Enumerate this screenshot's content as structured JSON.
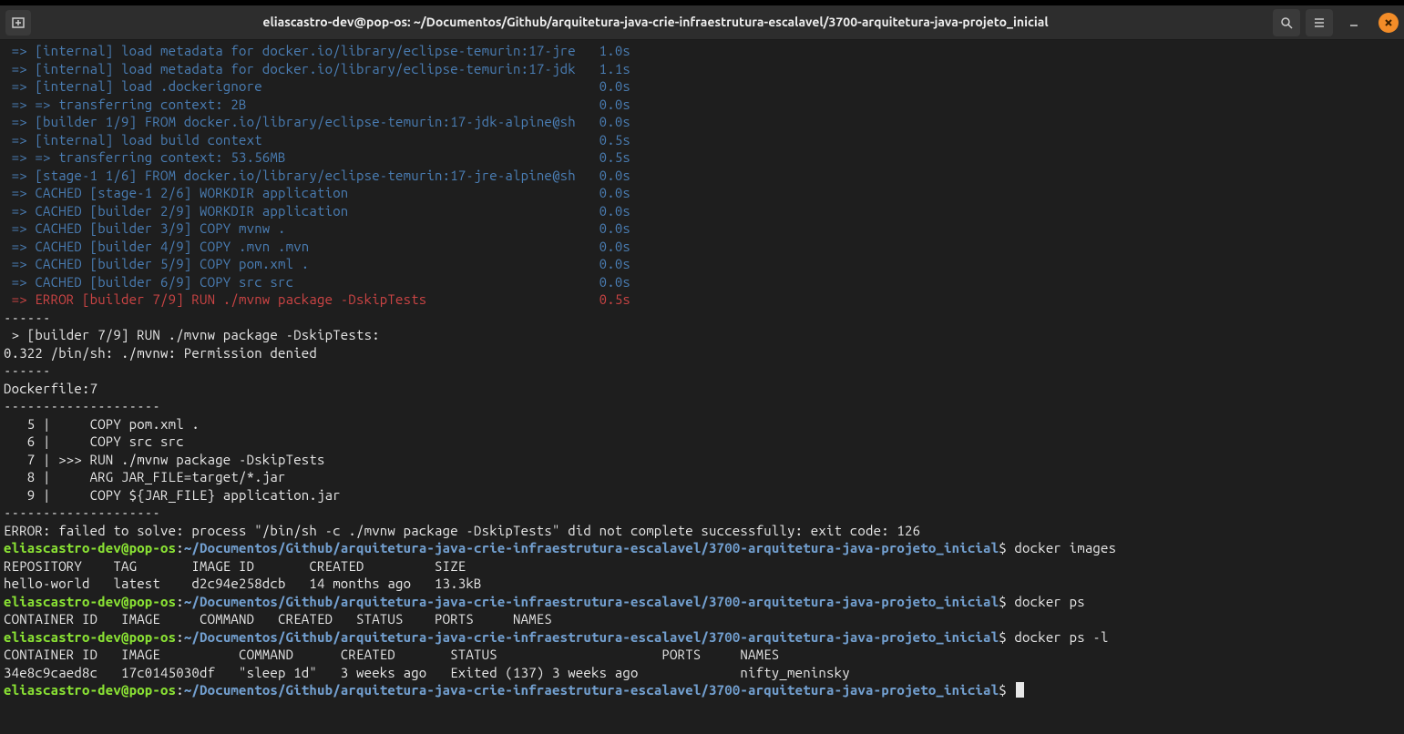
{
  "title": "eliascastro-dev@pop-os: ~/Documentos/Github/arquitetura-java-crie-infraestrutura-escalavel/3700-arquitetura-java-projeto_inicial",
  "build_lines": [
    {
      "text": "[internal] load metadata for docker.io/library/eclipse-temurin:17-jre",
      "time": "1.0s",
      "err": false
    },
    {
      "text": "[internal] load metadata for docker.io/library/eclipse-temurin:17-jdk",
      "time": "1.1s",
      "err": false
    },
    {
      "text": "[internal] load .dockerignore",
      "time": "0.0s",
      "err": false
    },
    {
      "text": "=> transferring context: 2B",
      "time": "0.0s",
      "err": false
    },
    {
      "text": "[builder 1/9] FROM docker.io/library/eclipse-temurin:17-jdk-alpine@sh",
      "time": "0.0s",
      "err": false
    },
    {
      "text": "[internal] load build context",
      "time": "0.5s",
      "err": false
    },
    {
      "text": "=> transferring context: 53.56MB",
      "time": "0.5s",
      "err": false
    },
    {
      "text": "[stage-1 1/6] FROM docker.io/library/eclipse-temurin:17-jre-alpine@sh",
      "time": "0.0s",
      "err": false
    },
    {
      "text": "CACHED [stage-1 2/6] WORKDIR application",
      "time": "0.0s",
      "err": false
    },
    {
      "text": "CACHED [builder 2/9] WORKDIR application",
      "time": "0.0s",
      "err": false
    },
    {
      "text": "CACHED [builder 3/9] COPY mvnw .",
      "time": "0.0s",
      "err": false
    },
    {
      "text": "CACHED [builder 4/9] COPY .mvn .mvn",
      "time": "0.0s",
      "err": false
    },
    {
      "text": "CACHED [builder 5/9] COPY pom.xml .",
      "time": "0.0s",
      "err": false
    },
    {
      "text": "CACHED [builder 6/9] COPY src src",
      "time": "0.0s",
      "err": false
    },
    {
      "text": "ERROR [builder 7/9] RUN ./mvnw package -DskipTests",
      "time": "0.5s",
      "err": true
    }
  ],
  "error_block": {
    "sep1": "------",
    "header": " > [builder 7/9] RUN ./mvnw package -DskipTests:",
    "perm": "0.322 /bin/sh: ./mvnw: Permission denied",
    "sep2": "------",
    "dockerfile": "Dockerfile:7",
    "dashes": "--------------------",
    "lines": [
      "   5 |     COPY pom.xml .",
      "   6 |     COPY src src",
      "   7 | >>> RUN ./mvnw package -DskipTests",
      "   8 |     ARG JAR_FILE=target/*.jar",
      "   9 |     COPY ${JAR_FILE} application.jar"
    ],
    "dashes2": "--------------------",
    "final": "ERROR: failed to solve: process \"/bin/sh -c ./mvnw package -DskipTests\" did not complete successfully: exit code: 126"
  },
  "prompt": {
    "user": "eliascastro-dev@pop-os",
    "sep": ":",
    "path": "~/Documentos/Github/arquitetura-java-crie-infraestrutura-escalavel/3700-arquitetura-java-projeto_inicial",
    "dollar": "$"
  },
  "commands": {
    "images": " docker images",
    "ps": " docker ps",
    "psl": " docker ps -l"
  },
  "images_output": {
    "header": "REPOSITORY    TAG       IMAGE ID       CREATED         SIZE",
    "row": "hello-world   latest    d2c94e258dcb   14 months ago   13.3kB"
  },
  "ps_output": {
    "header": "CONTAINER ID   IMAGE     COMMAND   CREATED   STATUS    PORTS     NAMES"
  },
  "psl_output": {
    "header": "CONTAINER ID   IMAGE          COMMAND      CREATED       STATUS                     PORTS     NAMES",
    "row": "34e8c9caed8c   17c0145030df   \"sleep 1d\"   3 weeks ago   Exited (137) 3 weeks ago             nifty_meninsky"
  }
}
